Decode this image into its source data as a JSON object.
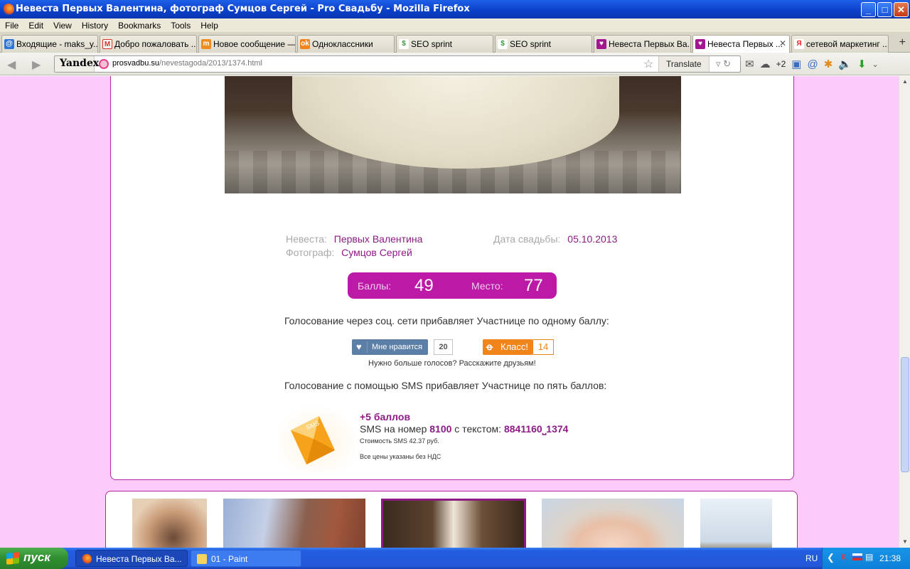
{
  "window": {
    "title": "Невеста Первых Валентина, фотограф Сумцов Сергей - Pro Свадьбу - Mozilla Firefox",
    "buttons": {
      "minimize": "_",
      "maximize": "□",
      "close": "✕"
    }
  },
  "menu": [
    "File",
    "Edit",
    "View",
    "History",
    "Bookmarks",
    "Tools",
    "Help"
  ],
  "tabs": [
    {
      "label": "Входящие - maks_y...",
      "icon": "yandex-mail-icon",
      "color": "#2a77d8"
    },
    {
      "label": "Добро пожаловать ...",
      "icon": "gmail-icon",
      "color": "#d93025"
    },
    {
      "label": "Новое сообщение —...",
      "icon": "mail-ru-icon",
      "color": "#ef8c1e"
    },
    {
      "label": "Одноклассники",
      "icon": "odnoklassniki-icon",
      "color": "#f2841c"
    },
    {
      "label": "SEO sprint",
      "icon": "dollar-icon",
      "color": "#3a9a3a"
    },
    {
      "label": "SEO sprint",
      "icon": "dollar-icon",
      "color": "#3a9a3a"
    },
    {
      "label": "Невеста Первых Ва...",
      "icon": "heart-icon",
      "color": "#a3168f"
    },
    {
      "label": "Невеста Первых ...",
      "icon": "heart-icon",
      "color": "#a3168f",
      "active": true
    },
    {
      "label": "сетевой маркетинг ...",
      "icon": "yandex-icon",
      "color": "#e22"
    }
  ],
  "nav": {
    "search_engine": "Yandex",
    "url_host": "prosvadbu.su",
    "url_path": "/nevestagoda/2013/1374.html",
    "translate": "Translate",
    "extra_count": "+2"
  },
  "page": {
    "bride_label": "Невеста:",
    "bride_value": "Первых Валентина",
    "date_label": "Дата свадьбы:",
    "date_value": "05.10.2013",
    "photographer_label": "Фотограф:",
    "photographer_value": "Сумцов Сергей",
    "score_label": "Баллы:",
    "score_value": "49",
    "place_label": "Место:",
    "place_value": "77",
    "social_note": "Голосование через соц. сети прибавляет Участнице по одному баллу:",
    "vk_label": "Мне нравится",
    "vk_count": "20",
    "ok_label": "Класс!",
    "ok_count": "14",
    "tell_friends": "Нужно больше голосов? Расскажите друзьям!",
    "sms_note": "Голосование с помощью SMS прибавляет Участнице по пять баллов:",
    "sms_icon_text": "SMS",
    "sms_plus": "+5 баллов",
    "sms_line_prefix": "SMS на номер",
    "sms_number": "8100",
    "sms_line_mid": "с текстом:",
    "sms_text": "8841160⎵1374",
    "sms_cost": "Стоимость SMS 42.37 руб.",
    "sms_vat": "Все цены указаны без НДС"
  },
  "taskbar": {
    "start": "пуск",
    "tasks": [
      {
        "label": "Невеста Первых Ва...",
        "icon": "firefox-icon"
      },
      {
        "label": "01 - Paint",
        "icon": "paint-icon"
      }
    ],
    "lang": "RU",
    "time": "21:38"
  },
  "colors": {
    "accent": "#bd19a7",
    "value": "#8c1b85",
    "page_bg": "#fccbfb"
  }
}
